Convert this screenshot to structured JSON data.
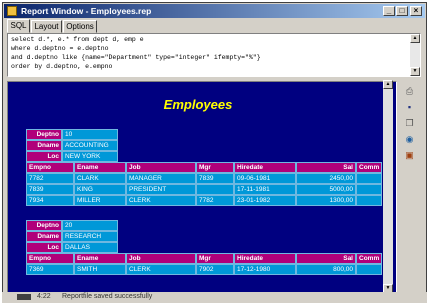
{
  "window": {
    "title": "Report Window - Employees.rep",
    "min": "_",
    "max": "□",
    "close": "×"
  },
  "tabs": [
    "SQL",
    "Layout",
    "Options"
  ],
  "sql_lines": [
    "select d.*, e.* from dept d, emp e",
    "where d.deptno = e.deptno",
    "and d.deptno like {name=\"Department\" type=\"integer\" ifempty=\"%\"}",
    "order by d.deptno, e.empno"
  ],
  "report": {
    "title": "Employees",
    "dept_labels": [
      "Deptno",
      "Dname",
      "Loc"
    ],
    "emp_headers": [
      "Empno",
      "Ename",
      "Job",
      "Mgr",
      "Hiredate",
      "Sal",
      "Comm"
    ],
    "depts": [
      {
        "deptno": "10",
        "dname": "ACCOUNTING",
        "loc": "NEW YORK",
        "rows": [
          [
            "7782",
            "CLARK",
            "MANAGER",
            "7839",
            "09-06-1981",
            "2450,00",
            ""
          ],
          [
            "7839",
            "KING",
            "PRESIDENT",
            "",
            "17-11-1981",
            "5000,00",
            ""
          ],
          [
            "7934",
            "MILLER",
            "CLERK",
            "7782",
            "23-01-1982",
            "1300,00",
            ""
          ]
        ]
      },
      {
        "deptno": "20",
        "dname": "RESEARCH",
        "loc": "DALLAS",
        "rows": [
          [
            "7369",
            "SMITH",
            "CLERK",
            "7902",
            "17-12-1980",
            "800,00",
            ""
          ]
        ]
      }
    ]
  },
  "toolbar_icons": [
    "print-icon",
    "save-icon",
    "copy-icon",
    "export-icon",
    "book-icon"
  ],
  "status": {
    "line": "4:22",
    "message": "Reportfile saved successfully"
  }
}
